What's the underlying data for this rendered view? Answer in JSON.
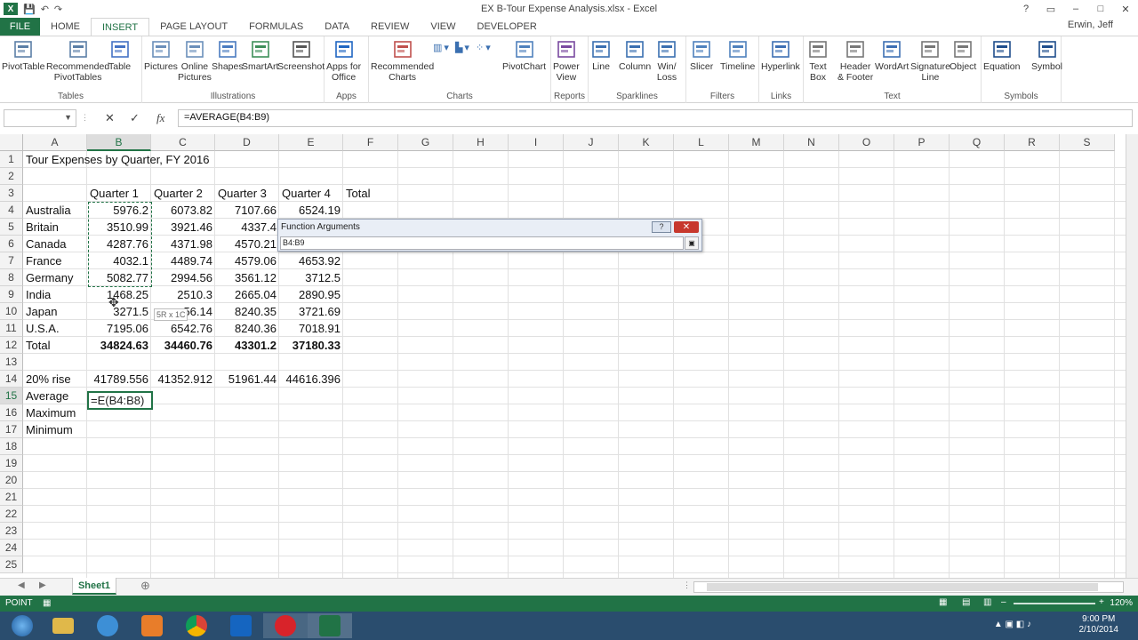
{
  "window": {
    "title": "EX B-Tour Expense Analysis.xlsx - Excel",
    "user": "Erwin, Jeff"
  },
  "tabs": [
    "FILE",
    "HOME",
    "INSERT",
    "PAGE LAYOUT",
    "FORMULAS",
    "DATA",
    "REVIEW",
    "VIEW",
    "DEVELOPER"
  ],
  "ribbon": {
    "groups": {
      "tables": "Tables",
      "illustrations": "Illustrations",
      "apps": "Apps",
      "charts": "Charts",
      "reports": "Reports",
      "sparklines": "Sparklines",
      "filters": "Filters",
      "links": "Links",
      "text": "Text",
      "symbols": "Symbols"
    },
    "buttons": {
      "pivottable": "PivotTable",
      "recpivot": "Recommended\nPivotTables",
      "table": "Table",
      "pictures": "Pictures",
      "online": "Online\nPictures",
      "shapes": "Shapes",
      "smartart": "SmartArt",
      "screenshot": "Screenshot",
      "apps": "Apps for\nOffice",
      "reccharts": "Recommended\nCharts",
      "pivotchart": "PivotChart",
      "powerview": "Power\nView",
      "line": "Line",
      "column": "Column",
      "winloss": "Win/\nLoss",
      "slicer": "Slicer",
      "timeline": "Timeline",
      "hyperlink": "Hyperlink",
      "textbox": "Text\nBox",
      "headerfooter": "Header\n& Footer",
      "wordart": "WordArt",
      "sigline": "Signature\nLine",
      "object": "Object",
      "equation": "Equation",
      "symbol": "Symbol"
    }
  },
  "formula_bar": {
    "name_box": "",
    "formula": "=AVERAGE(B4:B9)"
  },
  "columns": [
    "A",
    "B",
    "C",
    "D",
    "E",
    "F",
    "G",
    "H",
    "I",
    "J",
    "K",
    "L",
    "M",
    "N",
    "O",
    "P",
    "Q",
    "R",
    "S"
  ],
  "rows": [
    "1",
    "2",
    "3",
    "4",
    "5",
    "6",
    "7",
    "8",
    "9",
    "10",
    "11",
    "12",
    "13",
    "14",
    "15",
    "16",
    "17",
    "18",
    "19",
    "20",
    "21",
    "22",
    "23",
    "24",
    "25"
  ],
  "cells": {
    "title": "Tour Expenses by Quarter, FY 2016",
    "headers": [
      "Quarter 1",
      "Quarter 2",
      "Quarter 3",
      "Quarter 4",
      "Total"
    ],
    "data": [
      [
        "Australia",
        "5976.2",
        "6073.82",
        "7107.66",
        "6524.19"
      ],
      [
        "Britain",
        "3510.99",
        "3921.46",
        "4337.4",
        ""
      ],
      [
        "Canada",
        "4287.76",
        "4371.98",
        "4570.21",
        ""
      ],
      [
        "France",
        "4032.1",
        "4489.74",
        "4579.06",
        "4653.92"
      ],
      [
        "Germany",
        "5082.77",
        "2994.56",
        "3561.12",
        "3712.5"
      ],
      [
        "India",
        "1468.25",
        "2510.3",
        "2665.04",
        "2890.95"
      ],
      [
        "Japan",
        "3271.5",
        "56.14",
        "8240.35",
        "3721.69"
      ],
      [
        "U.S.A.",
        "7195.06",
        "6542.76",
        "8240.36",
        "7018.91"
      ]
    ],
    "total": [
      "Total",
      "34824.63",
      "34460.76",
      "43301.2",
      "37180.33"
    ],
    "rise": [
      "20% rise",
      "41789.556",
      "41352.912",
      "51961.44",
      "44616.396"
    ],
    "labels": [
      "Average",
      "Maximum",
      "Minimum"
    ],
    "active_text": "=E(B4:B8)",
    "tip": "5R x 1C"
  },
  "dialog": {
    "title": "Function Arguments",
    "help": "?",
    "close": "✕",
    "input": "B4:B9"
  },
  "sheet": {
    "tab": "Sheet1"
  },
  "status": {
    "mode": "POINT",
    "zoom": "120%"
  },
  "clock": {
    "time": "9:00 PM",
    "date": "2/10/2014"
  }
}
